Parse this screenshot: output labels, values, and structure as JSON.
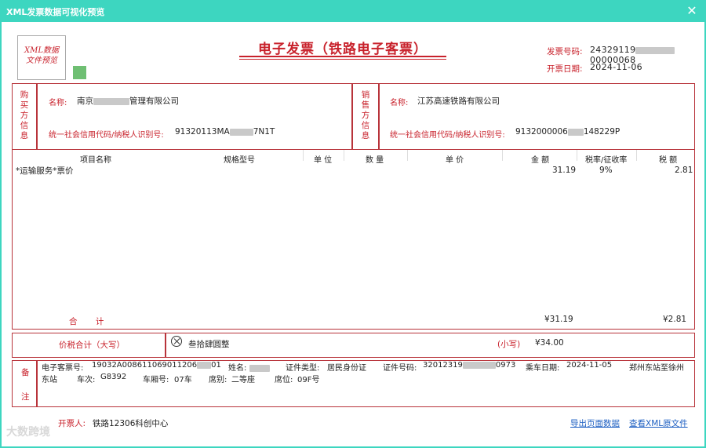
{
  "window": {
    "title": "XML发票数据可视化预览",
    "close": "✕"
  },
  "logo": {
    "line1": "XML数据",
    "line2": "文件预览"
  },
  "invoice": {
    "title": "电子发票（铁路电子客票）",
    "number_label": "发票号码:",
    "number_value": "24329119",
    "number_tail": "00000068",
    "date_label": "开票日期:",
    "date_value": "2024-11-06"
  },
  "buyer": {
    "section_label": [
      "购",
      "买",
      "方",
      "信",
      "息"
    ],
    "name_label": "名称:",
    "name_prefix": "南京",
    "name_suffix": "管理有限公司",
    "tax_label": "统一社会信用代码/纳税人识别号:",
    "tax_prefix": "91320113MA",
    "tax_suffix": "7N1T"
  },
  "seller": {
    "section_label": [
      "销",
      "售",
      "方",
      "信",
      "息"
    ],
    "name_label": "名称:",
    "name_value": "江苏高速铁路有限公司",
    "tax_label": "统一社会信用代码/纳税人识别号:",
    "tax_prefix": "9132000006",
    "tax_suffix": "148229P"
  },
  "table": {
    "headers": [
      "项目名称",
      "规格型号",
      "单 位",
      "数 量",
      "单 价",
      "金 额",
      "税率/征收率",
      "税 额"
    ],
    "row": {
      "name": "*运输服务*票价",
      "amount": "31.19",
      "rate": "9%",
      "tax": "2.81"
    },
    "total_label": "合 计",
    "total_amount": "¥31.19",
    "total_tax": "¥2.81"
  },
  "sum": {
    "label": "价税合计（大写）",
    "upper": "叁拾肆圆整",
    "lower_label": "(小写)",
    "lower_value": "¥34.00"
  },
  "remarks": {
    "label_top": "备",
    "label_bottom": "注",
    "ticket_no_label": "电子客票号:",
    "ticket_no_value": "19032A008611069011206",
    "ticket_no_tail": "01",
    "name_label": "姓名:",
    "id_type_label": "证件类型:",
    "id_type_value": "居民身份证",
    "id_no_label": "证件号码:",
    "id_no_prefix": "32012319",
    "id_no_tail": "0973",
    "date_label": "乘车日期:",
    "date_value": "2024-11-05",
    "route_start": "郑州东站至徐州",
    "route_end": "东站",
    "train_label": "车次:",
    "train_value": "G8392",
    "car_label": "车厢号:",
    "car_value": "07车",
    "seat_class_label": "席别:",
    "seat_class_value": "二等座",
    "seat_label": "席位:",
    "seat_value": "09F号"
  },
  "footer": {
    "issuer_label": "开票人:",
    "issuer_value": "铁路12306科创中心",
    "export_link": "导出页面数据",
    "view_xml_link": "查看XML原文件"
  },
  "watermark": {
    "text": "大数跨境"
  }
}
